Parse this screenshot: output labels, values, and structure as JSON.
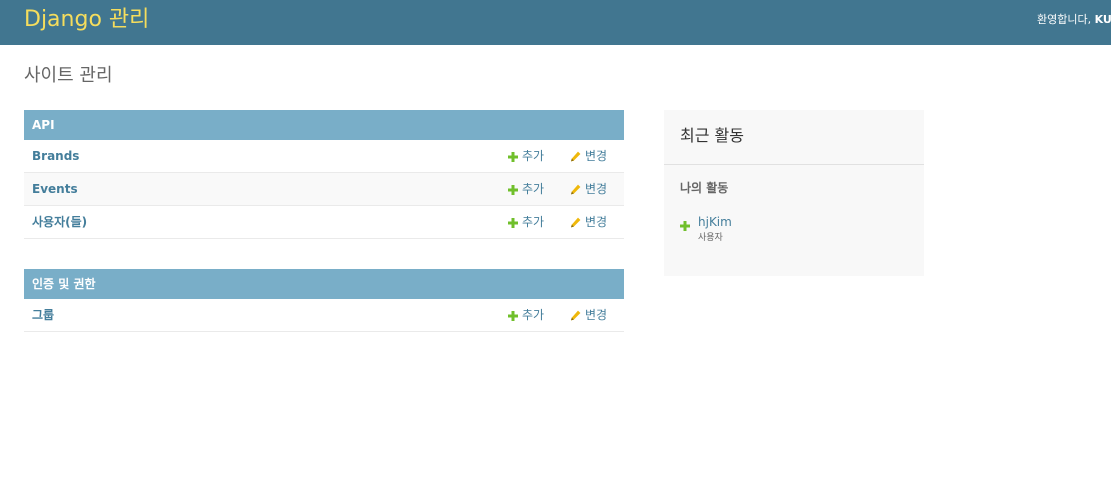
{
  "header": {
    "branding": "Django 관리",
    "welcome_text": "환영합니다, ",
    "username": "KUI"
  },
  "page": {
    "title": "사이트 관리"
  },
  "modules": [
    {
      "caption": "API",
      "rows": [
        {
          "name": "Brands",
          "add_label": "추가",
          "change_label": "변경"
        },
        {
          "name": "Events",
          "add_label": "추가",
          "change_label": "변경"
        },
        {
          "name": "사용자(들)",
          "add_label": "추가",
          "change_label": "변경"
        }
      ]
    },
    {
      "caption": "인증 및 권한",
      "rows": [
        {
          "name": "그룹",
          "add_label": "추가",
          "change_label": "변경"
        }
      ]
    }
  ],
  "recent_actions": {
    "title": "최근 활동",
    "subtitle": "나의 활동",
    "items": [
      {
        "object": "hjKim",
        "content_type": "사용자",
        "action_icon": "add-icon"
      }
    ]
  },
  "colors": {
    "header_bg": "#417690",
    "branding": "#f5dd5d",
    "caption_bg": "#79aec8",
    "link": "#447e9b",
    "add_icon": "#70bf2b",
    "change_icon": "#efb80b"
  }
}
